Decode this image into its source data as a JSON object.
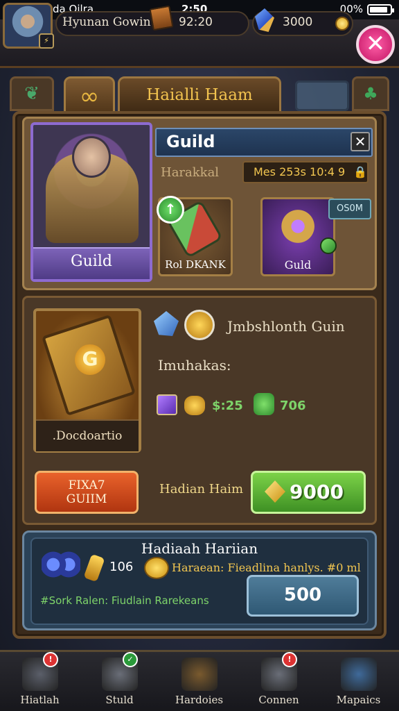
{
  "status_bar": {
    "carrier": "Plep Bsada Qilra",
    "time": "2:50",
    "battery": "00%",
    "battery_level": 0.9
  },
  "hud": {
    "player_name": "Hyunan Gowin",
    "gold": "92:20",
    "gems": "3000",
    "level": "⚡"
  },
  "tabs": {
    "title": "Haialli Haam",
    "active_icon": "guild-knot-icon",
    "left_icon": "guild-crest-icon",
    "right_icon": "clover-icon"
  },
  "panel_top": {
    "hero_label": "Guild",
    "header_title": "Guild",
    "sub_label": "Harakkal",
    "timer": "Mes 253s 10:4 9",
    "item1_label": "Rol DKANK",
    "item2_label": "Guld",
    "chip": "OS0M"
  },
  "panel_guild": {
    "emblem_letter": "G",
    "emblem_label": ".Docdoartio",
    "title": "Jmbshlonth Guin",
    "subtitle": "Imuhakas:",
    "stat1": "$:25",
    "stat2": "706",
    "btn_left": "FIXA7\nGUIIM",
    "mid_label": "Hadian Haim",
    "btn_right": "9000"
  },
  "panel_bottom": {
    "title": "Hadiaah Hariian",
    "count": "106",
    "line": "Haraean: Fieadlina hanlys. #0 ml",
    "footer": "#Sork Ralen: Fiudlain Rarekeans",
    "button": "500"
  },
  "nav": [
    {
      "label": "Hiatlah",
      "icon": "anvil-icon",
      "badge": "!",
      "badge_color": "#d33"
    },
    {
      "label": "Stuld",
      "icon": "shield-icon",
      "badge": "✓",
      "badge_color": "#2a9a3a"
    },
    {
      "label": "Hardoies",
      "icon": "hammer-icon",
      "badge": "",
      "badge_color": ""
    },
    {
      "label": "Connen",
      "icon": "forge-icon",
      "badge": "!",
      "badge_color": "#d33"
    },
    {
      "label": "Mapaics",
      "icon": "globe-icon",
      "badge": "",
      "badge_color": ""
    }
  ],
  "colors": {
    "accent_gold": "#f2c34f",
    "green_button": "#5ab236",
    "orange_button": "#d04a1d",
    "blue_button": "#3f6a86",
    "close_pink": "#e0307f"
  }
}
